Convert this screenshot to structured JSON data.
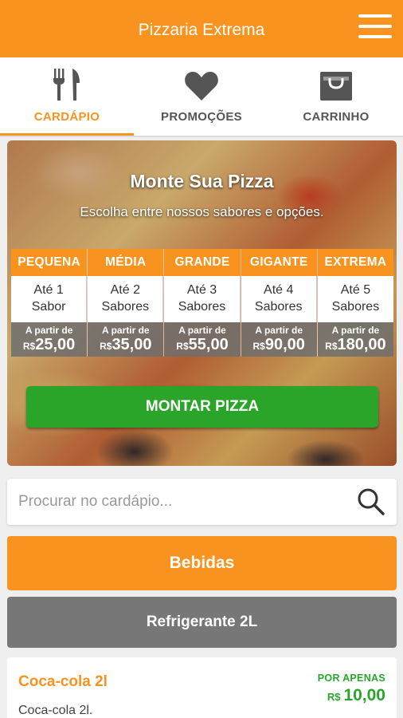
{
  "app": {
    "title": "Pizzaria Extrema"
  },
  "tabs": [
    {
      "label": "CARDÁPIO",
      "icon": "fork-knife-icon",
      "active": true
    },
    {
      "label": "PROMOÇÕES",
      "icon": "heart-icon",
      "active": false
    },
    {
      "label": "CARRINHO",
      "icon": "shopping-bag-icon",
      "active": false
    }
  ],
  "hero": {
    "title": "Monte Sua Pizza",
    "subtitle": "Escolha entre nossos sabores e opções.",
    "button_label": "MONTAR PIZZA",
    "sizes": [
      {
        "name": "PEQUENA",
        "desc_line1": "Até 1",
        "desc_line2": "Sabor",
        "from": "A partir de",
        "currency": "R$",
        "price": "25,00"
      },
      {
        "name": "MÉDIA",
        "desc_line1": "Até 2",
        "desc_line2": "Sabores",
        "from": "A partir de",
        "currency": "R$",
        "price": "35,00"
      },
      {
        "name": "GRANDE",
        "desc_line1": "Até 3",
        "desc_line2": "Sabores",
        "from": "A partir de",
        "currency": "R$",
        "price": "55,00"
      },
      {
        "name": "GIGANTE",
        "desc_line1": "Até 4",
        "desc_line2": "Sabores",
        "from": "A partir de",
        "currency": "R$",
        "price": "90,00"
      },
      {
        "name": "EXTREMA",
        "desc_line1": "Até 5",
        "desc_line2": "Sabores",
        "from": "A partir de",
        "currency": "R$",
        "price": "180,00"
      }
    ]
  },
  "search": {
    "placeholder": "Procurar no cardápio...",
    "value": ""
  },
  "category": {
    "label": "Bebidas"
  },
  "subcategory": {
    "label": "Refrigerante 2L"
  },
  "product": {
    "name": "Coca-cola 2l",
    "description": "Coca-cola 2l.",
    "price_tag": "POR APENAS",
    "currency": "R$",
    "price": "10,00"
  },
  "colors": {
    "accent": "#f7931e",
    "success": "#2aa52a",
    "neutral": "#777777"
  }
}
